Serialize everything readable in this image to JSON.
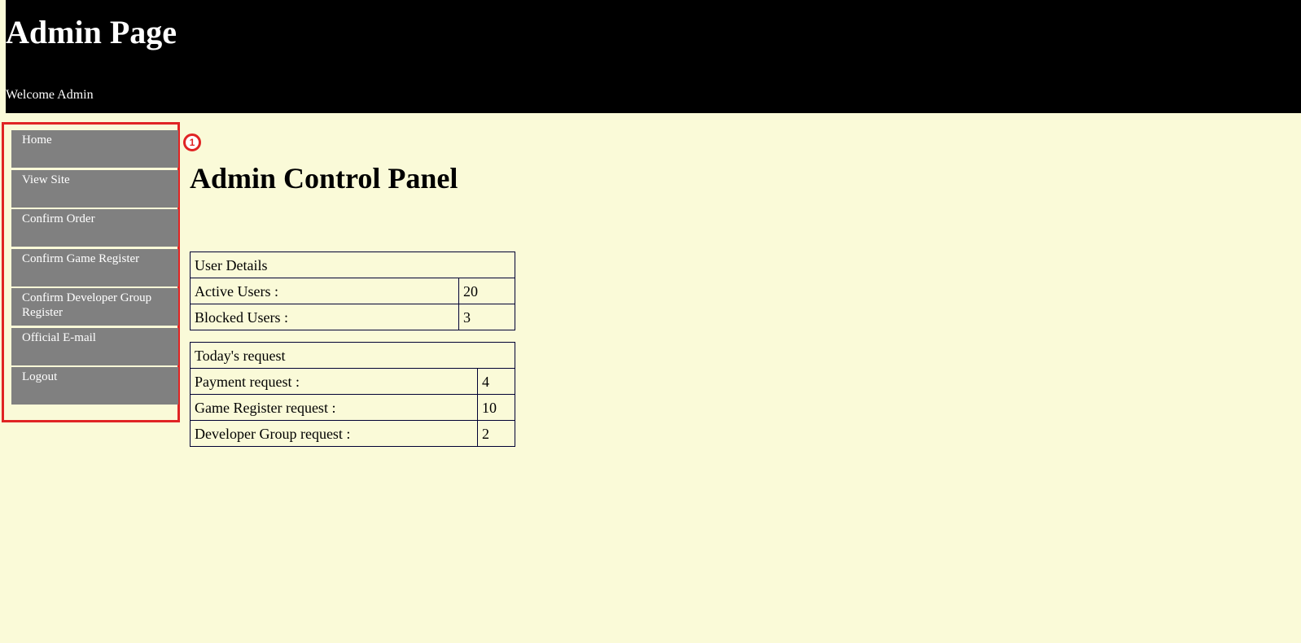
{
  "header": {
    "title": "Admin Page",
    "welcome": "Welcome Admin"
  },
  "sidebar": {
    "items": [
      {
        "label": "Home"
      },
      {
        "label": "View Site"
      },
      {
        "label": "Confirm Order"
      },
      {
        "label": "Confirm Game Register"
      },
      {
        "label": "Confirm Developer Group Register"
      },
      {
        "label": "Official E-mail"
      },
      {
        "label": "Logout"
      }
    ]
  },
  "marker": {
    "label": "1"
  },
  "main": {
    "title": "Admin Control Panel",
    "user_details": {
      "header": "User Details",
      "rows": [
        {
          "label": "Active Users :",
          "value": "20"
        },
        {
          "label": "Blocked Users :",
          "value": "3"
        }
      ]
    },
    "todays_request": {
      "header": "Today's request",
      "rows": [
        {
          "label": "Payment request :",
          "value": "4"
        },
        {
          "label": "Game Register request :",
          "value": "10"
        },
        {
          "label": "Developer Group request :",
          "value": "2"
        }
      ]
    }
  },
  "colors": {
    "background": "#fafad8",
    "header_bg": "#000000",
    "nav_bg": "#808080",
    "highlight": "#e02424"
  }
}
